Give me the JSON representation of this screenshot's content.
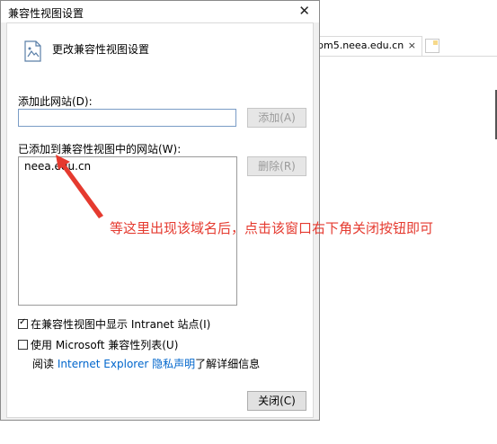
{
  "background": {
    "tab_label": "bm5.neea.edu.cn",
    "tab_close": "×"
  },
  "dialog": {
    "title": "兼容性视图设置",
    "close_glyph": "✕",
    "header_text": "更改兼容性视图设置",
    "add_site_label": "添加此网站(D):",
    "add_site_value": "",
    "add_button": "添加(A)",
    "added_sites_label": "已添加到兼容性视图中的网站(W):",
    "sites": [
      "neea.edu.cn"
    ],
    "remove_button": "删除(R)",
    "intranet_checkbox_label": "在兼容性视图中显示 Intranet 站点(I)",
    "intranet_checked": true,
    "ms_list_checkbox_label": "使用 Microsoft 兼容性列表(U)",
    "ms_list_checked": false,
    "read_prefix": "阅读",
    "read_link": "Internet Explorer 隐私声明",
    "read_suffix": "了解详细信息",
    "close_button": "关闭(C)"
  },
  "annotation": {
    "text": "等这里出现该域名后，点击该窗口右下角关闭按钮即可",
    "color": "#e53a2f"
  }
}
